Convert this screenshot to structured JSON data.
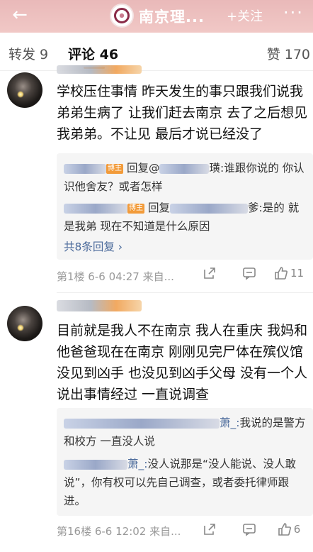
{
  "nav": {
    "title": "南京理...",
    "follow": "+关注",
    "more": "···"
  },
  "tabs": {
    "forward": "转发 9",
    "comments": "评论 46",
    "likes": "赞 170"
  },
  "comments": [
    {
      "text": "学校压住事情 昨天发生的事只跟我们说我弟弟生病了 让我们赶去南京 去了之后想见我弟弟。不让见 最后才说已经没了",
      "replies": [
        {
          "badge": "博主",
          "prefix": "回复@",
          "suffix": "璜:",
          "text": "谁跟你说的 你认识他舍友？或者怎样"
        },
        {
          "badge": "博主",
          "prefix": "回复",
          "suffix": "爹:",
          "text": "是的 就是我弟 现在不知道是什么原因"
        }
      ],
      "more_replies": "共8条回复 ›",
      "meta": "第1楼 6-6 04:27 来自...",
      "like_count": "11"
    },
    {
      "text": "目前就是我人不在南京 我人在重庆 我妈和他爸爸现在在南京 刚刚见完尸体在殡仪馆 没见到凶手 也没见到凶手父母 没有一个人说出事情经过 一直说调查",
      "replies": [
        {
          "suffix": "萧_:",
          "text": "我说的是警方和校方 一直没人说"
        },
        {
          "suffix": "萧_:",
          "text": "没人说那是“没人能说、没人敢说”，你有权可以先自己调查，或者委托律师跟进。"
        }
      ],
      "meta": "第16楼 6-6 12:02 来自...",
      "like_count": "6"
    }
  ],
  "icons": {
    "back": "back-arrow-icon",
    "share": "share-icon",
    "comment": "comment-icon",
    "like": "thumb-up-icon"
  },
  "colors": {
    "accent": "#ff8200",
    "link": "#4b6a9b",
    "header": "#efc3c1"
  }
}
